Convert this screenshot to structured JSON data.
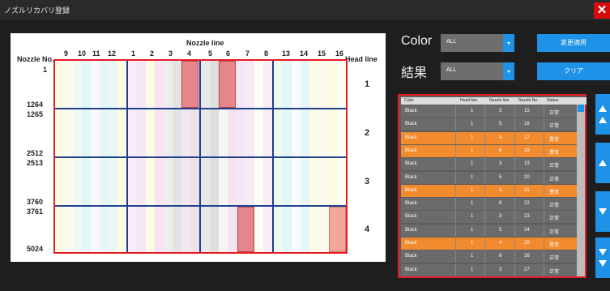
{
  "window": {
    "title": "ノズルリカバリ登録"
  },
  "icons": {
    "close": "close-icon"
  },
  "grid_panel": {
    "nozzle_no_header": "Nozzle No.",
    "nozzle_line_header": "Nozzle line",
    "head_line_header": "Head line",
    "nozzle_lines": [
      "9",
      "10",
      "11",
      "12",
      "1",
      "2",
      "3",
      "4",
      "5",
      "6",
      "7",
      "8",
      "13",
      "14",
      "15",
      "16"
    ],
    "nozzle_numbers": [
      "1",
      "1264",
      "1265",
      "2512",
      "2513",
      "3760",
      "3761",
      "5024"
    ],
    "head_lines": [
      "1",
      "2",
      "3",
      "4"
    ]
  },
  "filters": {
    "color_label": "Color",
    "color_value": "ALL",
    "result_label": "結果",
    "result_value": "ALL",
    "apply_button": "変更適用",
    "clear_button": "クリア"
  },
  "table": {
    "headers": [
      "Color",
      "Head line",
      "Nozzle line",
      "Nozzle No.",
      "Status"
    ],
    "rows": [
      {
        "color": "Black",
        "head": "1",
        "line": "3",
        "no": "15",
        "status": "正常",
        "state": "normal"
      },
      {
        "color": "Black",
        "head": "1",
        "line": "5",
        "no": "16",
        "status": "正常",
        "state": "normal"
      },
      {
        "color": "Black",
        "head": "1",
        "line": "4",
        "no": "17",
        "status": "異常",
        "state": "err"
      },
      {
        "color": "Black",
        "head": "1",
        "line": "6",
        "no": "18",
        "status": "異常",
        "state": "err"
      },
      {
        "color": "Black",
        "head": "1",
        "line": "3",
        "no": "19",
        "status": "正常",
        "state": "normal"
      },
      {
        "color": "Black",
        "head": "1",
        "line": "5",
        "no": "20",
        "status": "正常",
        "state": "normal"
      },
      {
        "color": "Black",
        "head": "1",
        "line": "4",
        "no": "21",
        "status": "異常",
        "state": "err"
      },
      {
        "color": "Black",
        "head": "1",
        "line": "6",
        "no": "22",
        "status": "正常",
        "state": "normal"
      },
      {
        "color": "Black",
        "head": "1",
        "line": "3",
        "no": "23",
        "status": "正常",
        "state": "normal"
      },
      {
        "color": "Black",
        "head": "1",
        "line": "5",
        "no": "24",
        "status": "正常",
        "state": "normal"
      },
      {
        "color": "Black",
        "head": "1",
        "line": "4",
        "no": "25",
        "status": "異常",
        "state": "err"
      },
      {
        "color": "Black",
        "head": "1",
        "line": "6",
        "no": "26",
        "status": "正常",
        "state": "normal"
      },
      {
        "color": "Black",
        "head": "1",
        "line": "3",
        "no": "27",
        "status": "正常",
        "state": "normal"
      }
    ]
  },
  "colors": {
    "accent": "#1e92e6",
    "error_row": "#f28a2e",
    "normal_row": "#6b6b6b",
    "highlight_border": "#e61b23"
  }
}
